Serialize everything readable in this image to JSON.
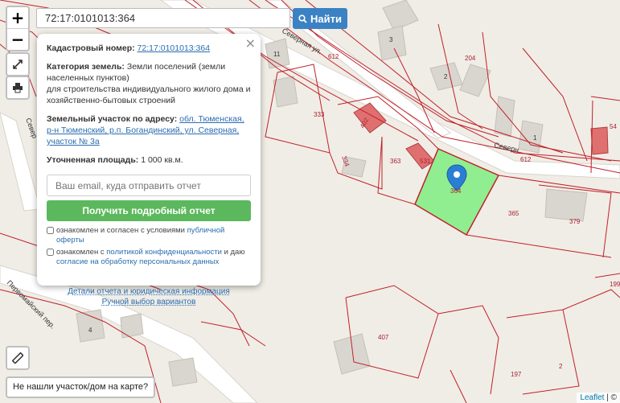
{
  "search": {
    "value": "72:17:0101013:364",
    "button_label": "Найти"
  },
  "popup": {
    "cadastral_label": "Кадастровый номер:",
    "cadastral_value": "72:17:0101013:364",
    "category_label": "Категория земель:",
    "category_value": "Земли поселений (земли населенных пунктов)",
    "usage_value": "для строительства индивидуального жилого дома и хозяйственно-бытовых строений",
    "address_label": "Земельный участок по адресу:",
    "address_value": "обл. Тюменская, р-н Тюменский, р.п. Богандинский, ул. Северная, участок № 3а",
    "area_label": "Уточненная площадь:",
    "area_value": "1 000 кв.м.",
    "email_placeholder": "Ваш email, куда отправить отчет",
    "report_button": "Получить подробный отчет",
    "offer_text": "ознакомлен и согласен с условиями",
    "offer_link": "публичной оферты",
    "privacy_text_1": "ознакомлен с",
    "privacy_link": "политикой конфиденциальности",
    "privacy_text_2": "и даю",
    "consent_link": "согласие на обработку персональных данных",
    "details_link": "Детали отчета и юридическая информация",
    "manual_link": "Ручной выбор вариантов"
  },
  "controls": {
    "zoom_in": "+",
    "zoom_out": "−"
  },
  "not_found_button": "Не нашли участок/дом на карте?",
  "attribution": {
    "leaflet": "Leaflet",
    "rest": "| ©"
  },
  "map": {
    "streets": [
      "Северная ул.",
      "Северн",
      "Первомайский пер.",
      "Север"
    ],
    "parcel_numbers": [
      "333",
      "334",
      "363",
      "364",
      "365",
      "379",
      "407",
      "197",
      "199",
      "612",
      "612",
      "531",
      "402",
      "54"
    ],
    "building_numbers": [
      "11",
      "3",
      "2",
      "1",
      "204",
      "4",
      "2"
    ],
    "highlight_color": "#90ee90",
    "parcel_line_color": "#c0202a",
    "marker_color": "#2a7fd4"
  }
}
